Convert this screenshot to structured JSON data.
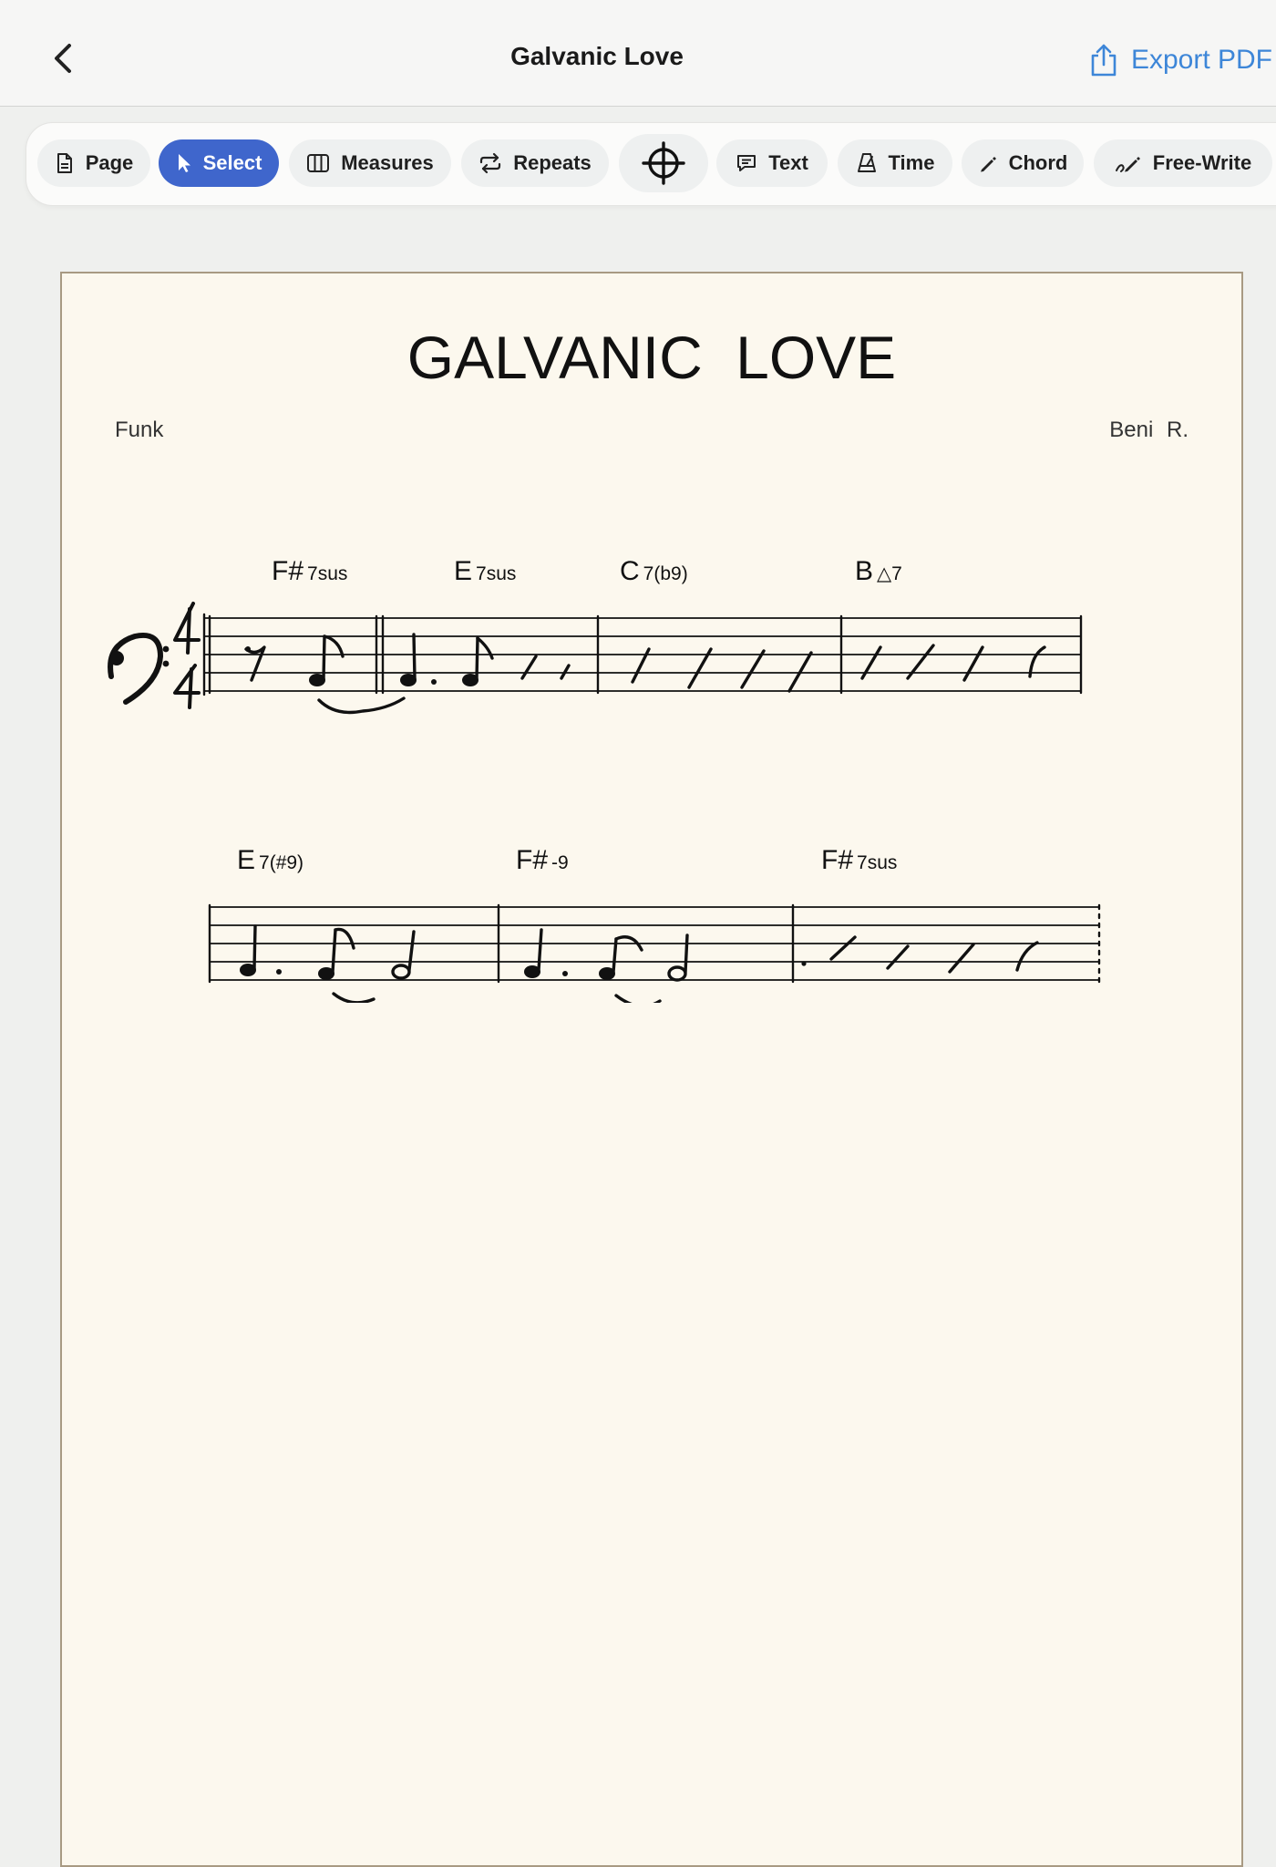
{
  "header": {
    "title": "Galvanic Love",
    "export_label": "Export PDF"
  },
  "toolbar": {
    "tools": [
      {
        "id": "page",
        "label": "Page",
        "icon": "page-icon"
      },
      {
        "id": "select",
        "label": "Select",
        "icon": "cursor-icon",
        "active": true
      },
      {
        "id": "measures",
        "label": "Measures",
        "icon": "measures-icon"
      },
      {
        "id": "repeats",
        "label": "Repeats",
        "icon": "repeat-icon"
      },
      {
        "id": "target",
        "label": "",
        "icon": "crosshair-icon"
      },
      {
        "id": "text",
        "label": "Text",
        "icon": "speech-bubble-icon"
      },
      {
        "id": "time",
        "label": "Time",
        "icon": "metronome-icon"
      },
      {
        "id": "chord",
        "label": "Chord",
        "icon": "pencil-icon"
      },
      {
        "id": "freewrite",
        "label": "Free-Write",
        "icon": "freehand-pen-icon"
      }
    ],
    "active_color": "#3f66cc"
  },
  "sheet": {
    "title": "GALVANIC  LOVE",
    "style": "Funk",
    "composer": "Beni  R.",
    "rows": [
      {
        "chords": [
          {
            "root": "F#",
            "quality": "7sus"
          },
          {
            "root": "E",
            "quality": "7sus"
          },
          {
            "root": "C",
            "quality": "7(b9)"
          },
          {
            "root": "B",
            "quality": "△7"
          }
        ]
      },
      {
        "chords": [
          {
            "root": "E",
            "quality": "7(#9)"
          },
          {
            "root": "F#",
            "quality": "-9"
          },
          {
            "root": "F#",
            "quality": "7sus"
          }
        ]
      }
    ]
  },
  "colors": {
    "accent": "#3d86d8",
    "paper": "#fcf8ee",
    "ink": "#111111"
  }
}
